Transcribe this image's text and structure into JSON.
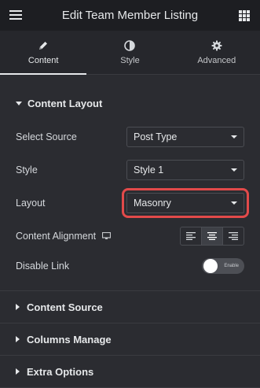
{
  "header": {
    "title": "Edit Team Member Listing"
  },
  "tabs": [
    {
      "label": "Content",
      "icon": "pencil-icon",
      "active": true
    },
    {
      "label": "Style",
      "icon": "half-circle-icon",
      "active": false
    },
    {
      "label": "Advanced",
      "icon": "gear-icon",
      "active": false
    }
  ],
  "content_layout": {
    "title": "Content Layout",
    "fields": {
      "select_source": {
        "label": "Select Source",
        "value": "Post Type"
      },
      "style": {
        "label": "Style",
        "value": "Style 1"
      },
      "layout": {
        "label": "Layout",
        "value": "Masonry"
      },
      "content_alignment": {
        "label": "Content Alignment",
        "options": [
          "left",
          "center",
          "right"
        ],
        "selected": "center"
      },
      "disable_link": {
        "label": "Disable Link",
        "toggle_text": "Enable",
        "on": false
      }
    }
  },
  "collapsed_sections": [
    {
      "title": "Content Source"
    },
    {
      "title": "Columns Manage"
    },
    {
      "title": "Extra Options"
    }
  ],
  "colors": {
    "background": "#2b2c31",
    "header": "#1d1e22",
    "highlight": "#e24a4a"
  }
}
